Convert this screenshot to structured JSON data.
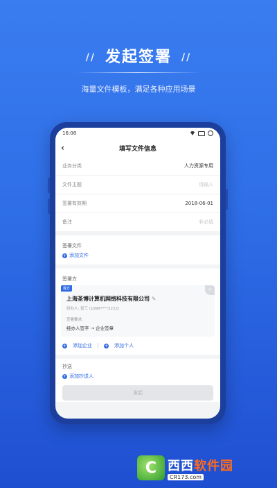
{
  "hero": {
    "title": "发起签署",
    "slashes_left": "//",
    "slashes_right": "//",
    "subtitle": "海量文件模板，满足各种应用场景"
  },
  "status": {
    "time": "16:08"
  },
  "nav": {
    "title": "填写文件信息",
    "back": "‹"
  },
  "form": {
    "rows": [
      {
        "label": "业务分类",
        "value": "人力资源专用",
        "placeholder": false
      },
      {
        "label": "文件主题",
        "value": "请输入",
        "placeholder": true
      },
      {
        "label": "签署有效期",
        "value": "2018-06-01",
        "placeholder": false
      },
      {
        "label": "备注",
        "value": "非必填",
        "placeholder": true
      }
    ]
  },
  "files": {
    "title": "签署文件",
    "add_label": "添加文件"
  },
  "signers": {
    "title": "签署方",
    "party": {
      "tag": "我方",
      "company": "上海圣博计算机网络科技有限公司",
      "handler": "经办人: 张三 (1999****2222)",
      "requirement_label": "签署要求:",
      "requirement": "经办人签字  →  企业签章",
      "delete": "×"
    },
    "add_company": "添加企业",
    "add_person": "添加个人"
  },
  "cc": {
    "title": "抄送",
    "add_label": "添加抄送人"
  },
  "submit_label": "发起",
  "watermark": {
    "logo": "C",
    "main_a": "西西",
    "main_b": "软件园",
    "url": "CR173.com"
  }
}
